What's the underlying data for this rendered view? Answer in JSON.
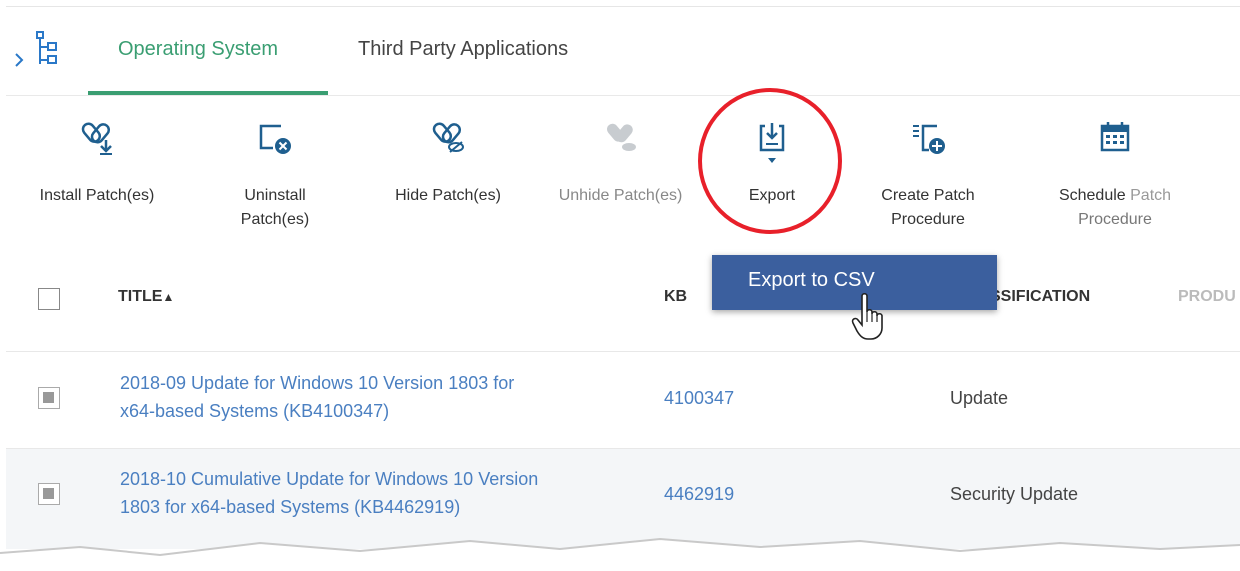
{
  "tabs": [
    {
      "label": "Operating System",
      "active": true
    },
    {
      "label": "Third Party Applications",
      "active": false
    }
  ],
  "toolbar": {
    "install": {
      "label": "Install Patch(es)",
      "icon": "install-patch-icon"
    },
    "uninstall": {
      "line1": "Uninstall",
      "line2": "Patch(es)",
      "icon": "uninstall-patch-icon"
    },
    "hide": {
      "label": "Hide Patch(es)",
      "icon": "hide-patch-icon"
    },
    "unhide": {
      "label": "Unhide Patch(es)",
      "icon": "unhide-patch-icon",
      "disabled": true
    },
    "export": {
      "label": "Export",
      "icon": "export-icon"
    },
    "create": {
      "line1": "Create Patch",
      "line2": "Procedure",
      "icon": "create-procedure-icon"
    },
    "schedule": {
      "line1a": "Schedule",
      "line1b": " Patch",
      "line2": "Procedure",
      "icon": "calendar-icon"
    }
  },
  "export_menu": {
    "item": "Export to CSV"
  },
  "table": {
    "headers": {
      "title": "TITLE",
      "sort_indicator": "▲",
      "kb": "KB",
      "classification": "SSIFICATION",
      "product": "PRODU"
    },
    "rows": [
      {
        "title_line1": "2018-09 Update for Windows 10 Version 1803 for",
        "title_line2": "x64-based Systems (KB4100347)",
        "kb": "4100347",
        "classification": "Update"
      },
      {
        "title_line1": "2018-10 Cumulative Update for Windows 10 Version",
        "title_line2": "1803 for x64-based Systems (KB4462919)",
        "kb": "4462919",
        "classification": "Security Update"
      }
    ]
  },
  "colors": {
    "accent": "#3a9e72",
    "link": "#4a7fc1",
    "menu_bg": "#3b5f9e",
    "highlight_circle": "#e8202a"
  }
}
